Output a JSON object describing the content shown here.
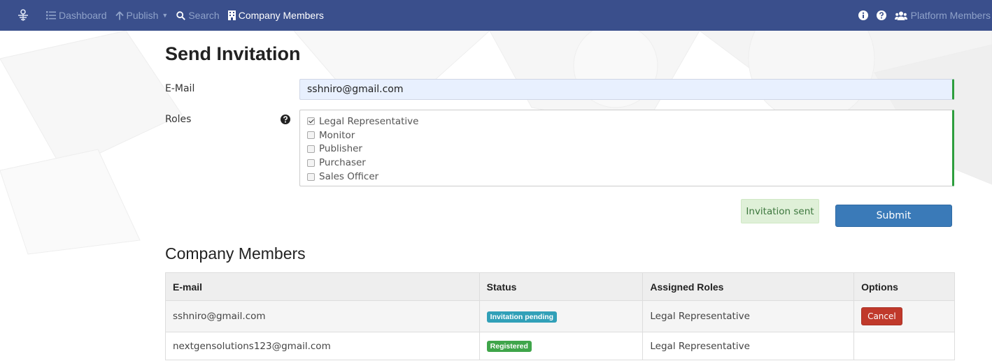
{
  "navbar": {
    "items": [
      {
        "label": "Dashboard",
        "icon": "list-icon"
      },
      {
        "label": "Publish",
        "icon": "arrow-up-icon",
        "has_dropdown": true
      },
      {
        "label": "Search",
        "icon": "search-icon"
      },
      {
        "label": "Company Members",
        "icon": "building-icon",
        "active": true
      }
    ],
    "right": {
      "info_icon": "info-circle-icon",
      "help_icon": "question-circle-icon",
      "platform_members_label": "Platform Members",
      "platform_members_icon": "users-icon"
    }
  },
  "invitation_form": {
    "title": "Send Invitation",
    "email_label": "E-Mail",
    "email_value": "sshniro@gmail.com",
    "roles_label": "Roles",
    "roles": [
      {
        "label": "Legal Representative",
        "checked": true
      },
      {
        "label": "Monitor",
        "checked": false
      },
      {
        "label": "Publisher",
        "checked": false
      },
      {
        "label": "Purchaser",
        "checked": false
      },
      {
        "label": "Sales Officer",
        "checked": false
      }
    ],
    "status_message": "Invitation sent",
    "submit_label": "Submit"
  },
  "members": {
    "title": "Company Members",
    "columns": [
      "E-mail",
      "Status",
      "Assigned Roles",
      "Options"
    ],
    "rows": [
      {
        "email": "sshniro@gmail.com",
        "status": "Invitation pending",
        "roles": "Legal Representative",
        "option": "Cancel"
      },
      {
        "email": "nextgensolutions123@gmail.com",
        "status": "Registered",
        "roles": "Legal Representative",
        "option": ""
      }
    ]
  },
  "colors": {
    "navbar_bg": "#3a4f8c",
    "nav_inactive": "#8fa2c9",
    "valid_border": "#2e9e3e",
    "submit_bg": "#3a7ab8",
    "pending_badge": "#31a0b8",
    "registered_badge": "#3fa54a",
    "cancel_bg": "#c0392b"
  }
}
